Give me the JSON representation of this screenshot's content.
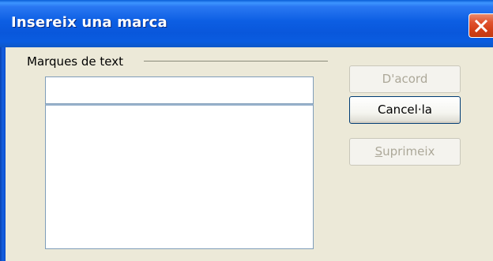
{
  "window": {
    "title": "Insereix una marca",
    "close_icon": "close-icon"
  },
  "group": {
    "label": "Marques de text"
  },
  "bookmark_input": {
    "value": ""
  },
  "bookmark_list": {
    "items": []
  },
  "buttons": {
    "ok_label": "D'acord",
    "cancel_label": "Cancel·la",
    "delete_label": "Suprimeix"
  },
  "colors": {
    "titlebar": "#0c5ee3",
    "close_button": "#e0532f",
    "dialog_background": "#ece9d8"
  }
}
